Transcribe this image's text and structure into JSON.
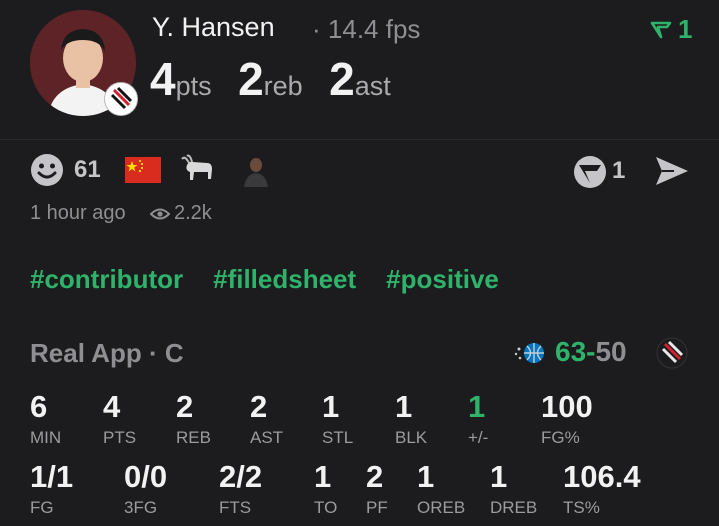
{
  "player": {
    "name": "Y. Hansen",
    "separator": "·",
    "fps": "14.4 fps"
  },
  "header_stats": [
    {
      "value": "4",
      "unit": "pts"
    },
    {
      "value": "2",
      "unit": "reb"
    },
    {
      "value": "2",
      "unit": "ast"
    }
  ],
  "upvote_count": "1",
  "reactions": {
    "count": "61"
  },
  "comment_count": "1",
  "post": {
    "time": "1 hour ago",
    "views": "2.2k"
  },
  "tags": [
    "#contributor",
    "#filledsheet",
    "#positive"
  ],
  "game": {
    "source": "Real App",
    "dot": "·",
    "grade": "C",
    "score_home": "63",
    "score_dash": "-",
    "score_away": "50"
  },
  "stats_row1": [
    {
      "value": "6",
      "label": "MIN"
    },
    {
      "value": "4",
      "label": "PTS"
    },
    {
      "value": "2",
      "label": "REB"
    },
    {
      "value": "2",
      "label": "AST"
    },
    {
      "value": "1",
      "label": "STL"
    },
    {
      "value": "1",
      "label": "BLK"
    },
    {
      "value": "1",
      "label": "+/-"
    },
    {
      "value": "100",
      "label": "FG%"
    }
  ],
  "stats_row2": [
    {
      "value": "1/1",
      "label": "FG"
    },
    {
      "value": "0/0",
      "label": "3FG"
    },
    {
      "value": "2/2",
      "label": "FTS"
    },
    {
      "value": "1",
      "label": "TO"
    },
    {
      "value": "2",
      "label": "PF"
    },
    {
      "value": "1",
      "label": "OREB"
    },
    {
      "value": "1",
      "label": "DREB"
    },
    {
      "value": "106.4",
      "label": "TS%"
    }
  ],
  "colors": {
    "background": "#1c1c1e",
    "accent_green": "#2fb36a",
    "muted": "#8e8e93"
  }
}
